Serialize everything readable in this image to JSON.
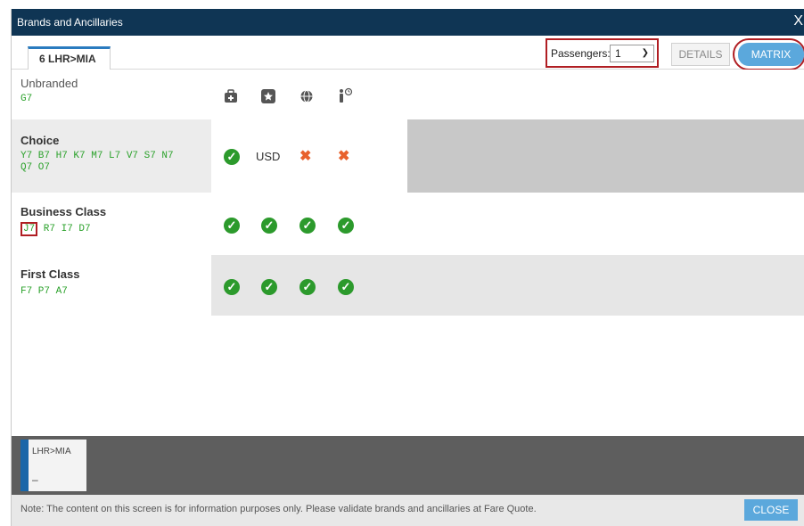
{
  "dialog": {
    "title": "Brands and Ancillaries",
    "close_glyph": "X"
  },
  "tabs": {
    "route_tab": "6 LHR>MIA"
  },
  "passengers": {
    "label": "Passengers:",
    "value": "1"
  },
  "view_toggle": {
    "details_label": "DETAILS",
    "matrix_label": "MATRIX",
    "active": "MATRIX"
  },
  "header_row": {
    "brand": "Unbranded",
    "codes": "G7",
    "icons": [
      "baggage-icon",
      "seat-star-icon",
      "wifi-globe-icon",
      "priority-boarding-icon"
    ]
  },
  "brands": [
    {
      "name": "Choice",
      "codes_line1": "Y7 B7 H7 K7 M7 L7 V7 S7 N7",
      "codes_line2": "Q7 O7",
      "cells": [
        "check",
        "USD",
        "cross",
        "cross"
      ]
    },
    {
      "name": "Business Class",
      "highlighted_code": "J7",
      "codes_rest": " R7 I7 D7",
      "cells": [
        "check",
        "check",
        "check",
        "check"
      ]
    },
    {
      "name": "First Class",
      "codes": "F7 P7 A7",
      "cells": [
        "check",
        "check",
        "check",
        "check"
      ]
    }
  ],
  "segment": {
    "label": "LHR>MIA",
    "value": "–"
  },
  "footer": {
    "note": "Note: The content on this screen is for information purposes only. Please validate brands and ancillaries at Fare Quote.",
    "close_label": "CLOSE"
  },
  "colors": {
    "title_bar": "#0f3554",
    "accent": "#5ba8dc",
    "check": "#2c9a2c",
    "cross": "#e8612c",
    "code_text": "#2aa12a",
    "highlight": "#b01e23"
  }
}
